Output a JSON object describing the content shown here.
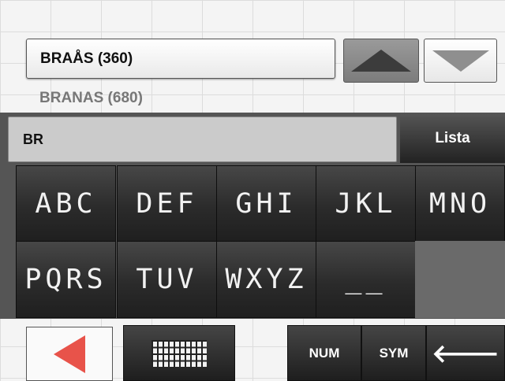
{
  "suggestion": {
    "selected": "BRAÅS (360)",
    "next": "BRANAS (680)"
  },
  "input": {
    "value": "BR"
  },
  "lista_label": "Lista",
  "keys": [
    "ABC",
    "DEF",
    "GHI",
    "JKL",
    "MNO",
    "PQRS",
    "TUV",
    "WXYZ",
    "__"
  ],
  "bottom": {
    "num_label": "NUM",
    "sym_label": "SYM",
    "backspace": "🡐"
  },
  "icons": {
    "up": "arrow-up-icon",
    "down": "arrow-down-icon",
    "back": "back-arrow-icon",
    "keyboard": "keyboard-icon",
    "backspace": "backspace-icon"
  },
  "colors": {
    "accent": "#e8534a",
    "key_bg": "#2b2b2b"
  }
}
